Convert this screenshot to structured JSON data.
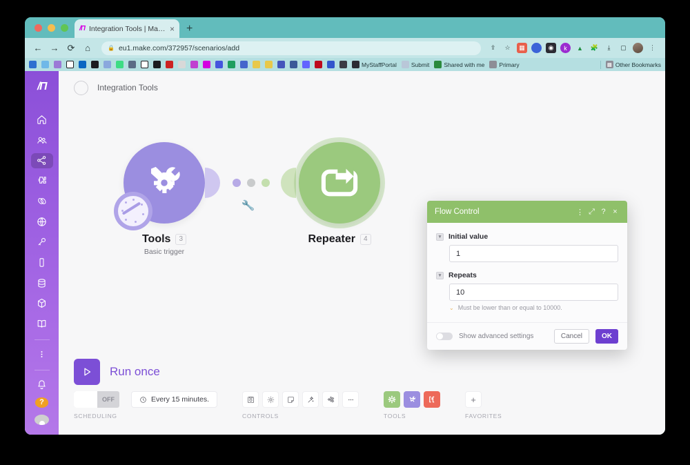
{
  "browser": {
    "tab": {
      "title": "Integration Tools | Make",
      "favicon": "make-logo-icon",
      "close": "×"
    },
    "new_tab_label": "+",
    "nav": {
      "back": "←",
      "forward": "→",
      "reload": "⟳",
      "home": "⌂"
    },
    "omnibox": {
      "url": "eu1.make.com/372957/scenarios/add",
      "lock": "🔒"
    },
    "toolbar_icons": [
      "share-icon",
      "bookmark-star-icon",
      "extension-red-icon",
      "extension-blue-icon",
      "extension-dark-icon",
      "extension-k-icon",
      "google-drive-icon",
      "extensions-puzzle-icon",
      "downloads-icon",
      "sidepanel-icon",
      "profile-avatar",
      "chrome-menu-icon"
    ],
    "bookmarks": [
      {
        "label": "",
        "icon": "infinity-icon",
        "color": "#2f6fd0"
      },
      {
        "label": "",
        "icon": "cloud-icon",
        "color": "#6fb8e8"
      },
      {
        "label": "",
        "icon": "drop-icon",
        "color": "#9b7ad6"
      },
      {
        "label": "",
        "icon": "github-icon",
        "color": "#ffffff"
      },
      {
        "label": "",
        "icon": "linkedin-icon",
        "color": "#0a66c2"
      },
      {
        "label": "",
        "icon": "ghost-icon",
        "color": "#1b1b1f"
      },
      {
        "label": "",
        "icon": "analytics-icon",
        "color": "#8aa8dd"
      },
      {
        "label": "",
        "icon": "android-icon",
        "color": "#3ddc84"
      },
      {
        "label": "",
        "icon": "building-icon",
        "color": "#5b6b85"
      },
      {
        "label": "",
        "icon": "r-light-icon",
        "color": "#ffffff"
      },
      {
        "label": "",
        "icon": "r-dark-icon",
        "color": "#1b1b1f"
      },
      {
        "label": "",
        "icon": "barcode-icon",
        "color": "#cc2222"
      },
      {
        "label": "",
        "icon": "circle-grey-icon",
        "color": "#d8d8d8"
      },
      {
        "label": "",
        "icon": "chat-icon",
        "color": "#c040d0"
      },
      {
        "label": "",
        "icon": "make-icon",
        "color": "#d400e0"
      },
      {
        "label": "",
        "icon": "discord-icon",
        "color": "#4455dd"
      },
      {
        "label": "",
        "icon": "green-circle-icon",
        "color": "#1d9e5e"
      },
      {
        "label": "",
        "icon": "x-cross-icon",
        "color": "#4466cc"
      },
      {
        "label": "",
        "icon": "moon-yellow-icon",
        "color": "#e8c84a"
      },
      {
        "label": "",
        "icon": "bee-icon",
        "color": "#e8c84a"
      },
      {
        "label": "",
        "icon": "k-icon",
        "color": "#4455bb"
      },
      {
        "label": "",
        "icon": "facebook-icon",
        "color": "#3b5998"
      },
      {
        "label": "",
        "icon": "mastodon-icon",
        "color": "#6364ff"
      },
      {
        "label": "",
        "icon": "pinterest-icon",
        "color": "#bd081c"
      },
      {
        "label": "",
        "icon": "clock-blue-icon",
        "color": "#3355cc"
      },
      {
        "label": "",
        "icon": "scan-icon",
        "color": "#3a3a44"
      },
      {
        "label": "MyStaffPortal",
        "icon": "owl-icon",
        "color": "#2b2b33"
      },
      {
        "label": "Submit",
        "icon": "snowflake-icon",
        "color": "#b9c7d8"
      },
      {
        "label": "Shared with me",
        "icon": "drive-icon",
        "color": "#2b8a3e"
      },
      {
        "label": "Primary",
        "icon": "folder-icon",
        "color": "#8d8d96"
      }
    ],
    "other_bookmarks": {
      "label": "Other Bookmarks",
      "icon": "folder-icon"
    }
  },
  "sidebar": {
    "logo": "make-logo",
    "items": [
      {
        "name": "home",
        "icon": "home-icon",
        "active": false
      },
      {
        "name": "team",
        "icon": "people-icon",
        "active": false
      },
      {
        "name": "scenarios",
        "icon": "share-nodes-icon",
        "active": true
      },
      {
        "name": "templates",
        "icon": "puzzle-icon",
        "active": false
      },
      {
        "name": "connections",
        "icon": "link-icon",
        "active": false
      },
      {
        "name": "webhooks",
        "icon": "globe-icon",
        "active": false
      },
      {
        "name": "keys",
        "icon": "key-icon",
        "active": false
      },
      {
        "name": "devices",
        "icon": "device-icon",
        "active": false
      },
      {
        "name": "data-stores",
        "icon": "database-icon",
        "active": false
      },
      {
        "name": "data-structures",
        "icon": "cube-icon",
        "active": false
      },
      {
        "name": "docs",
        "icon": "book-icon",
        "active": false
      },
      {
        "name": "more",
        "icon": "dots-vertical-icon",
        "active": false
      }
    ],
    "notifications_icon": "bell-icon",
    "help": {
      "icon": "help-icon",
      "label": "?"
    },
    "avatar": "user-avatar"
  },
  "page": {
    "back_icon": "arrow-left-icon",
    "title": "Integration Tools"
  },
  "canvas": {
    "modules": [
      {
        "name": "Tools",
        "badge": "3",
        "subtitle": "Basic trigger",
        "icon": "tools-wrench-screwdriver-gear-icon",
        "color": "#9b8ee0"
      },
      {
        "name": "Repeater",
        "badge": "4",
        "subtitle": "",
        "icon": "repeat-loop-icon",
        "color": "#9bc97e"
      }
    ],
    "connector_dots": [
      "#b7aae6",
      "#c9cbcc",
      "#c4dfae"
    ],
    "cursor_icon": "wrench-cursor-icon"
  },
  "dialog": {
    "title": "Flow Control",
    "header_color": "#8fc06a",
    "header_icons": [
      {
        "name": "menu-dots-icon",
        "glyph": "⋮"
      },
      {
        "name": "expand-icon",
        "glyph": "⤢"
      },
      {
        "name": "help-icon",
        "glyph": "?"
      },
      {
        "name": "close-icon",
        "glyph": "×"
      }
    ],
    "fields": [
      {
        "label": "Initial value",
        "value": "1",
        "checkbox": "chevron-down-icon",
        "hint": ""
      },
      {
        "label": "Repeats",
        "value": "10",
        "checkbox": "chevron-down-icon",
        "hint": "Must be lower than or equal to 10000."
      }
    ],
    "advanced_toggle": {
      "label": "Show advanced settings",
      "on": false
    },
    "cancel_label": "Cancel",
    "ok_label": "OK",
    "ok_color": "#6d3fd0"
  },
  "bottom": {
    "run_once": {
      "label": "Run once",
      "icon": "play-icon",
      "color": "#7c4fd6"
    },
    "scheduling": {
      "group_label": "SCHEDULING",
      "toggle_state": "OFF",
      "interval_label": "Every 15 minutes.",
      "clock_icon": "clock-icon"
    },
    "controls": {
      "group_label": "CONTROLS",
      "buttons": [
        {
          "name": "save-icon"
        },
        {
          "name": "settings-gear-icon"
        },
        {
          "name": "notes-icon"
        },
        {
          "name": "auto-align-icon"
        },
        {
          "name": "explain-flow-icon"
        },
        {
          "name": "more-options-icon"
        }
      ]
    },
    "tools": {
      "group_label": "TOOLS",
      "buttons": [
        {
          "name": "flow-control-tool",
          "icon": "gear-icon",
          "color": "#9bc97e"
        },
        {
          "name": "tools-tool",
          "icon": "tools-icon",
          "color": "#9b8ee0"
        },
        {
          "name": "text-parser-tool",
          "icon": "brackets-icon",
          "color": "#ed6a5a"
        }
      ]
    },
    "favorites": {
      "group_label": "FAVORITES",
      "add_label": "+"
    }
  }
}
